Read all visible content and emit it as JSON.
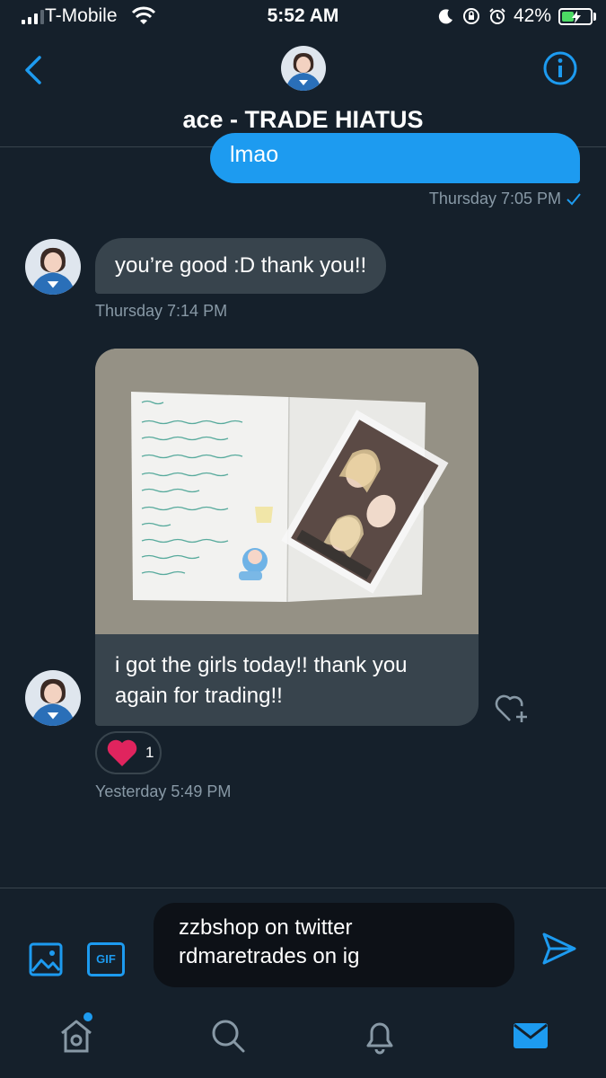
{
  "status_bar": {
    "carrier": "T-Mobile",
    "time": "5:52 AM",
    "battery_percent": "42%",
    "battery_level": 0.42,
    "icons": [
      "signal-icon",
      "wifi-icon",
      "moon-icon",
      "orientation-lock-icon",
      "alarm-icon",
      "battery-charging-icon"
    ]
  },
  "header": {
    "title": "ace - TRADE HIATUS",
    "back_icon": "chevron-left-icon",
    "info_icon": "info-icon"
  },
  "messages": [
    {
      "direction": "outgoing",
      "text": "lmao",
      "meta": "Thursday 7:05 PM",
      "status_icon": "checkmark-icon"
    },
    {
      "direction": "incoming",
      "text": "you’re good :D thank you!!",
      "meta": "Thursday 7:14 PM"
    },
    {
      "direction": "incoming",
      "has_photo": true,
      "text": "i got the girls today!! thank you again for trading!!",
      "reaction": {
        "icon": "heart-icon",
        "count": "1"
      },
      "meta": "Yesterday 5:49 PM"
    }
  ],
  "composer": {
    "value_line1": "zzbshop on twitter",
    "value_line2": "rdmaretrades on ig",
    "gif_label": "GIF",
    "image_icon": "image-icon",
    "send_icon": "send-icon"
  },
  "tabs": [
    {
      "name": "home",
      "icon": "home-icon",
      "has_notification_dot": true
    },
    {
      "name": "search",
      "icon": "search-icon"
    },
    {
      "name": "notifications",
      "icon": "bell-icon"
    },
    {
      "name": "messages",
      "icon": "mail-icon",
      "active": true
    }
  ],
  "colors": {
    "background": "#15202b",
    "accent": "#1d9bf0",
    "bubble_incoming": "#38444d",
    "meta_text": "#8899a6",
    "heart": "#e0245e"
  }
}
